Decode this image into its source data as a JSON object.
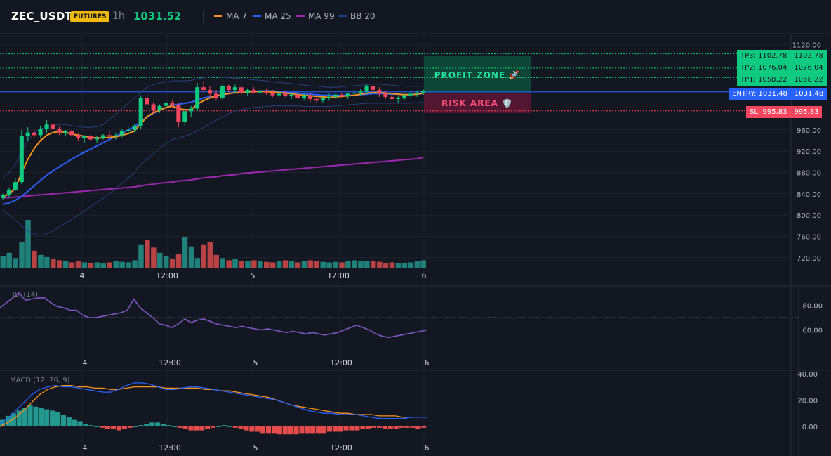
{
  "header": {
    "symbol": "ZEC_USDT",
    "badge": "FUTURES",
    "timeframe": "1h",
    "price": "1031.52"
  },
  "legend": [
    {
      "label": "MA 7",
      "color": "#f7931a"
    },
    {
      "label": "MA 25",
      "color": "#2962ff"
    },
    {
      "label": "MA 99",
      "color": "#9c27b0"
    },
    {
      "label": "BB 20",
      "color": "#1e3a8a"
    }
  ],
  "colors": {
    "up": "#0ecb81",
    "down": "#f6465d",
    "up_volume": "#26a69a",
    "down_volume": "#ef5350",
    "entry": "#2962ff",
    "sl": "#f6465d",
    "tp": "#0ecb81",
    "rsi": "#7e57c2"
  },
  "levels": {
    "tp3": {
      "label": "TP3: 1102.78",
      "value": "1102.78",
      "price": 1102.78
    },
    "tp2": {
      "label": "TP2: 1076.04",
      "value": "1076.04",
      "price": 1076.04
    },
    "tp1": {
      "label": "TP1: 1058.22",
      "value": "1058.22",
      "price": 1058.22
    },
    "entry": {
      "label": "ENTRY: 1031.48",
      "value": "1031.48",
      "price": 1031.48
    },
    "sl": {
      "label": "SL: 995.83",
      "value": "995.83",
      "price": 995.83
    }
  },
  "zones": {
    "profit": "PROFIT ZONE 🚀",
    "risk": "RISK AREA 🛡️"
  },
  "panes": {
    "rsi_label": "RSI (14)",
    "macd_label": "MACD (12, 26, 9)"
  },
  "chart_data": {
    "type": "candlestick",
    "price_axis": {
      "ticks": [
        "1120.00",
        "960.00",
        "920.00",
        "880.00",
        "840.00",
        "800.00",
        "760.00",
        "720.00"
      ],
      "range": [
        700,
        1130
      ]
    },
    "time_ticks": [
      "4",
      "12:00",
      "5",
      "12:00",
      "6"
    ],
    "ohlc": [
      [
        832,
        840,
        828,
        838
      ],
      [
        838,
        852,
        834,
        848
      ],
      [
        848,
        870,
        845,
        862
      ],
      [
        862,
        960,
        858,
        948
      ],
      [
        948,
        965,
        940,
        955
      ],
      [
        955,
        962,
        945,
        950
      ],
      [
        950,
        968,
        946,
        962
      ],
      [
        962,
        978,
        955,
        970
      ],
      [
        970,
        975,
        958,
        962
      ],
      [
        962,
        966,
        950,
        955
      ],
      [
        955,
        960,
        948,
        958
      ],
      [
        958,
        962,
        946,
        950
      ],
      [
        950,
        955,
        940,
        945
      ],
      [
        945,
        950,
        935,
        948
      ],
      [
        948,
        952,
        940,
        942
      ],
      [
        942,
        948,
        935,
        945
      ],
      [
        945,
        952,
        942,
        950
      ],
      [
        950,
        958,
        945,
        948
      ],
      [
        948,
        955,
        942,
        950
      ],
      [
        950,
        962,
        946,
        958
      ],
      [
        958,
        966,
        952,
        960
      ],
      [
        960,
        972,
        955,
        968
      ],
      [
        968,
        1025,
        962,
        1020
      ],
      [
        1020,
        1028,
        1000,
        1008
      ],
      [
        1008,
        1012,
        990,
        998
      ],
      [
        998,
        1008,
        992,
        1005
      ],
      [
        1005,
        1015,
        1000,
        1010
      ],
      [
        1010,
        1015,
        1002,
        1006
      ],
      [
        1006,
        1010,
        965,
        975
      ],
      [
        975,
        1000,
        968,
        995
      ],
      [
        995,
        1005,
        985,
        1000
      ],
      [
        1000,
        1048,
        995,
        1040
      ],
      [
        1040,
        1052,
        1030,
        1035
      ],
      [
        1035,
        1042,
        1020,
        1028
      ],
      [
        1028,
        1035,
        1015,
        1020
      ],
      [
        1020,
        1045,
        1015,
        1042
      ],
      [
        1042,
        1045,
        1030,
        1035
      ],
      [
        1035,
        1045,
        1028,
        1040
      ],
      [
        1040,
        1044,
        1025,
        1030
      ],
      [
        1030,
        1038,
        1025,
        1035
      ],
      [
        1035,
        1040,
        1028,
        1030
      ],
      [
        1030,
        1036,
        1025,
        1032
      ],
      [
        1032,
        1038,
        1026,
        1030
      ],
      [
        1030,
        1035,
        1022,
        1025
      ],
      [
        1025,
        1032,
        1020,
        1028
      ],
      [
        1028,
        1034,
        1022,
        1024
      ],
      [
        1024,
        1030,
        1018,
        1026
      ],
      [
        1026,
        1030,
        1018,
        1020
      ],
      [
        1020,
        1028,
        1015,
        1025
      ],
      [
        1025,
        1030,
        1012,
        1018
      ],
      [
        1018,
        1025,
        1010,
        1015
      ],
      [
        1015,
        1022,
        1010,
        1020
      ],
      [
        1020,
        1028,
        1015,
        1022
      ],
      [
        1022,
        1030,
        1018,
        1026
      ],
      [
        1026,
        1030,
        1020,
        1024
      ],
      [
        1024,
        1030,
        1018,
        1028
      ],
      [
        1028,
        1035,
        1022,
        1030
      ],
      [
        1030,
        1036,
        1025,
        1032
      ],
      [
        1032,
        1045,
        1028,
        1042
      ],
      [
        1042,
        1048,
        1030,
        1035
      ],
      [
        1035,
        1040,
        1022,
        1028
      ],
      [
        1028,
        1034,
        1018,
        1022
      ],
      [
        1022,
        1028,
        1015,
        1018
      ],
      [
        1018,
        1024,
        1010,
        1020
      ],
      [
        1020,
        1028,
        1015,
        1025
      ],
      [
        1025,
        1032,
        1020,
        1028
      ],
      [
        1028,
        1034,
        1022,
        1030
      ],
      [
        1030,
        1036,
        1026,
        1034
      ]
    ],
    "volume": [
      22,
      28,
      18,
      48,
      90,
      32,
      24,
      20,
      16,
      14,
      12,
      10,
      12,
      10,
      9,
      10,
      9,
      10,
      12,
      11,
      10,
      14,
      44,
      52,
      38,
      28,
      22,
      16,
      26,
      58,
      40,
      18,
      44,
      48,
      24,
      18,
      14,
      16,
      13,
      12,
      14,
      12,
      11,
      10,
      12,
      14,
      12,
      10,
      12,
      14,
      12,
      11,
      10,
      11,
      10,
      12,
      14,
      12,
      13,
      12,
      11,
      9,
      10,
      8,
      9,
      10,
      12,
      14
    ],
    "ma7": [
      834,
      840,
      850,
      880,
      905,
      925,
      940,
      950,
      955,
      957,
      955,
      952,
      950,
      948,
      946,
      945,
      945,
      946,
      947,
      950,
      953,
      958,
      972,
      985,
      992,
      997,
      1002,
      1005,
      1000,
      998,
      998,
      1008,
      1015,
      1020,
      1024,
      1026,
      1028,
      1030,
      1030,
      1031,
      1032,
      1032,
      1032,
      1031,
      1030,
      1029,
      1028,
      1026,
      1025,
      1024,
      1023,
      1022,
      1021,
      1022,
      1023,
      1024,
      1025,
      1027,
      1029,
      1030,
      1030,
      1029,
      1028,
      1027,
      1026,
      1026,
      1027,
      1029
    ],
    "ma25": [
      820,
      823,
      828,
      835,
      845,
      855,
      865,
      875,
      883,
      891,
      898,
      905,
      912,
      918,
      924,
      930,
      936,
      942,
      948,
      954,
      960,
      966,
      975,
      984,
      991,
      997,
      1002,
      1006,
      1008,
      1010,
      1012,
      1016,
      1020,
      1022,
      1024,
      1026,
      1028,
      1030,
      1031,
      1032,
      1032,
      1033,
      1033,
      1033,
      1032,
      1031,
      1030,
      1029,
      1028,
      1027,
      1026,
      1025,
      1025,
      1025,
      1025,
      1025,
      1025,
      1026,
      1027,
      1028,
      1028,
      1028,
      1027,
      1027,
      1026,
      1026,
      1027,
      1028
    ],
    "ma99": [
      832,
      833,
      834,
      835,
      836,
      837,
      838,
      839,
      840,
      841,
      842,
      843,
      844,
      845,
      846,
      847,
      848,
      849,
      850,
      851,
      852,
      853,
      855,
      857,
      858,
      860,
      861,
      862,
      864,
      865,
      866,
      868,
      870,
      871,
      872,
      874,
      875,
      876,
      878,
      879,
      880,
      881,
      882,
      883,
      884,
      885,
      886,
      887,
      888,
      889,
      890,
      891,
      892,
      893,
      894,
      895,
      896,
      897,
      898,
      899,
      900,
      901,
      902,
      903,
      904,
      905,
      906,
      908
    ],
    "bb_upper": [
      870,
      880,
      895,
      920,
      940,
      955,
      962,
      965,
      968,
      970,
      970,
      968,
      966,
      965,
      965,
      966,
      970,
      980,
      990,
      1000,
      1010,
      1020,
      1030,
      1040,
      1045,
      1048,
      1050,
      1052,
      1052,
      1052,
      1053,
      1056,
      1058,
      1060,
      1060,
      1059,
      1058,
      1057,
      1056,
      1055,
      1054,
      1053,
      1052,
      1050,
      1049,
      1048,
      1047,
      1046,
      1044,
      1043,
      1042,
      1041,
      1040,
      1040,
      1041,
      1042,
      1043,
      1044,
      1045,
      1046,
      1046,
      1045,
      1044,
      1043,
      1042,
      1042,
      1042,
      1042
    ],
    "bb_lower": [
      810,
      800,
      790,
      780,
      770,
      765,
      762,
      765,
      770,
      778,
      785,
      792,
      800,
      808,
      816,
      824,
      832,
      840,
      850,
      860,
      870,
      880,
      895,
      905,
      915,
      925,
      935,
      942,
      945,
      948,
      952,
      958,
      965,
      972,
      978,
      984,
      990,
      995,
      998,
      1000,
      1002,
      1003,
      1004,
      1005,
      1005,
      1005,
      1005,
      1005,
      1004,
      1004,
      1004,
      1004,
      1004,
      1005,
      1006,
      1007,
      1008,
      1009,
      1010,
      1010,
      1010,
      1010,
      1010,
      1010,
      1010,
      1010,
      1011,
      1012
    ],
    "rsi": [
      78,
      82,
      86,
      90,
      84,
      85,
      86,
      86,
      82,
      79,
      78,
      76,
      76,
      72,
      70,
      70,
      71,
      72,
      73,
      74,
      76,
      85,
      78,
      74,
      70,
      65,
      64,
      62,
      65,
      69,
      66,
      68,
      69,
      67,
      65,
      64,
      63,
      62,
      63,
      62,
      61,
      60,
      61,
      60,
      59,
      58,
      59,
      58,
      57,
      58,
      57,
      56,
      57,
      58,
      60,
      62,
      64,
      62,
      60,
      57,
      55,
      54,
      55,
      56,
      57,
      58,
      59,
      60
    ],
    "rsi_ticks": [
      "80.00",
      "60.00"
    ],
    "macd_line": [
      2,
      6,
      12,
      18,
      24,
      28,
      30,
      31,
      30,
      30,
      29,
      28,
      27,
      26,
      26,
      28,
      31,
      33,
      33,
      32,
      30,
      28,
      28,
      29,
      30,
      30,
      29,
      28,
      27,
      26,
      25,
      24,
      23,
      22,
      21,
      20,
      18,
      16,
      14,
      12,
      11,
      10,
      10,
      9,
      9,
      9,
      8,
      7,
      6,
      6,
      6,
      6,
      7,
      7,
      7
    ],
    "macd_signal": [
      0,
      3,
      7,
      12,
      18,
      24,
      28,
      30,
      31,
      31,
      30,
      30,
      29,
      29,
      28,
      28,
      29,
      30,
      30,
      30,
      30,
      29,
      29,
      29,
      29,
      29,
      28,
      28,
      27,
      27,
      26,
      25,
      24,
      23,
      22,
      20,
      18,
      16,
      15,
      14,
      13,
      12,
      11,
      10,
      10,
      9,
      9,
      9,
      8,
      8,
      8,
      7,
      7,
      7,
      7
    ],
    "macd_hist": [
      5,
      8,
      10,
      12,
      14,
      16,
      15,
      14,
      13,
      12,
      11,
      9,
      7,
      5,
      4,
      2,
      1,
      0,
      -1,
      -2,
      -2,
      -3,
      -2,
      -1,
      0,
      1,
      2,
      3,
      3,
      2,
      1,
      0,
      -1,
      -2,
      -3,
      -3,
      -3,
      -2,
      -1,
      0,
      1,
      0,
      -1,
      -2,
      -3,
      -4,
      -4,
      -5,
      -5,
      -5,
      -6,
      -6,
      -6,
      -6,
      -5,
      -5,
      -5,
      -5,
      -5,
      -4,
      -4,
      -4,
      -3,
      -3,
      -3,
      -2,
      -2,
      -1,
      -1,
      -2,
      -2,
      -2,
      -1,
      -1,
      -1,
      -2,
      -1
    ],
    "macd_ticks": [
      "40.00",
      "20.00",
      "0.00"
    ]
  }
}
